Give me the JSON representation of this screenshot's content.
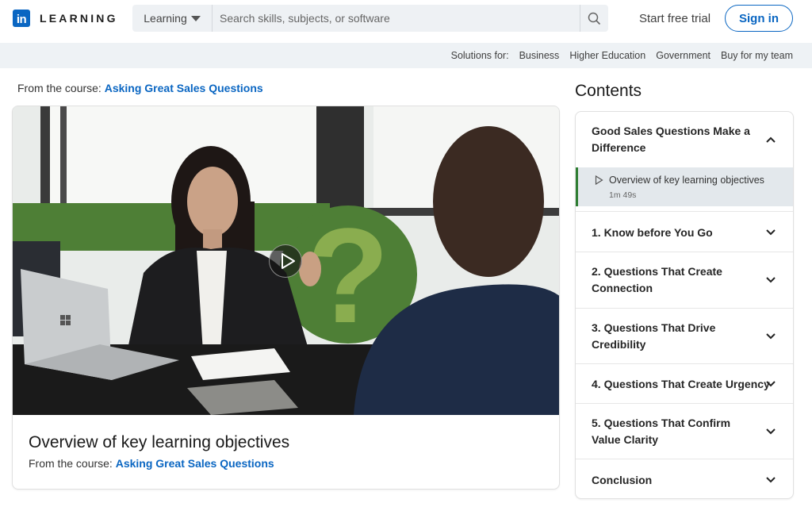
{
  "header": {
    "logo_text": "LEARNING",
    "logo_badge": "in",
    "search_scope": "Learning",
    "search_placeholder": "Search skills, subjects, or software",
    "search_value": "",
    "start_trial": "Start free trial",
    "sign_in": "Sign in"
  },
  "subnav": {
    "label": "Solutions for:",
    "links": [
      "Business",
      "Higher Education",
      "Government",
      "Buy for my team"
    ]
  },
  "main": {
    "from_course_prefix": "From the course:",
    "course_title": "Asking Great Sales Questions",
    "video_title": "Overview of key learning objectives",
    "brand_green": "#4e7f36",
    "brand_blue": "#0a66c2"
  },
  "contents": {
    "title": "Contents",
    "sections": [
      {
        "label": "Good Sales Questions Make a Difference",
        "expanded": true
      },
      {
        "label": "1. Know before You Go",
        "expanded": false
      },
      {
        "label": "2. Questions That Create Connection",
        "expanded": false
      },
      {
        "label": "3. Questions That Drive Credibility",
        "expanded": false
      },
      {
        "label": "4. Questions That Create Urgency",
        "expanded": false
      },
      {
        "label": "5. Questions That Confirm Value Clarity",
        "expanded": false
      },
      {
        "label": "Conclusion",
        "expanded": false
      }
    ],
    "active_lesson": {
      "label": "Overview of key learning objectives",
      "duration": "1m 49s"
    }
  }
}
